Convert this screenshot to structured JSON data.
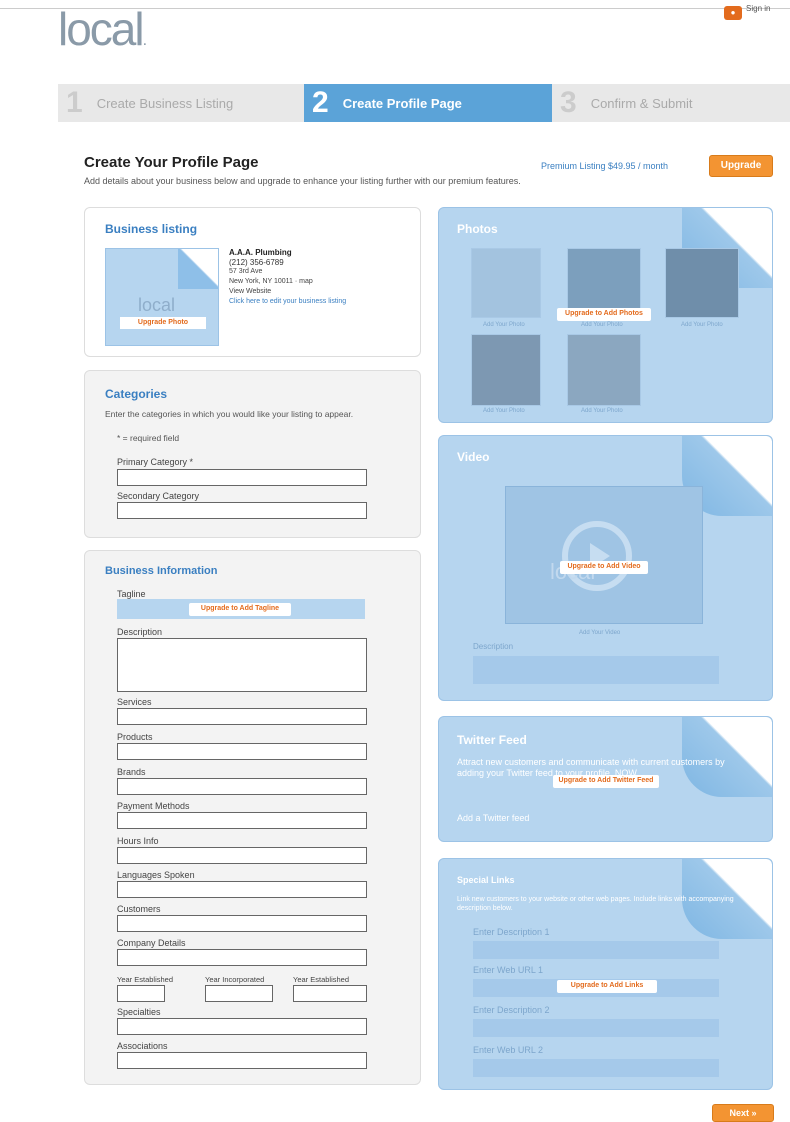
{
  "header": {
    "logo": "local",
    "logo_dot": ".",
    "signin": "Sign in"
  },
  "steps": [
    {
      "num": "1",
      "label": "Create Business Listing"
    },
    {
      "num": "2",
      "label": "Create Profile Page"
    },
    {
      "num": "3",
      "label": "Confirm & Submit"
    }
  ],
  "page": {
    "title": "Create Your Profile Page",
    "subtitle": "Add details about your business below and upgrade to enhance your listing further with our premium features.",
    "premium_text": "Premium Listing $49.95 / month",
    "upgrade_label": "Upgrade"
  },
  "business_listing": {
    "title": "Business listing",
    "name": "A.A.A. Plumbing",
    "phone": "(212) 356-6789",
    "address1": "57 3rd Ave",
    "address2": "New York, NY 10011 · map",
    "website": "View Website",
    "edit_link": "Click here to edit your business listing",
    "logo_text": "local",
    "upgrade_photo": "Upgrade Photo"
  },
  "categories": {
    "title": "Categories",
    "intro": "Enter the categories in which you would like your listing to appear.",
    "required_note": "* = required field",
    "primary_label": "Primary Category *",
    "secondary_label": "Secondary Category"
  },
  "business_info": {
    "title": "Business Information",
    "tagline_label": "Tagline",
    "tagline_btn": "Upgrade to Add Tagline",
    "description_label": "Description",
    "fields": [
      "Services",
      "Products",
      "Brands",
      "Payment Methods",
      "Hours Info",
      "Languages Spoken",
      "Customers",
      "Company Details"
    ],
    "triple": [
      "Year Established",
      "Year Incorporated",
      "Year Established"
    ],
    "specialties_label": "Specialties",
    "associations_label": "Associations"
  },
  "photos": {
    "title": "Photos",
    "upgrade_btn": "Upgrade to Add Photos",
    "captions": [
      "Add Your Photo",
      "Add Your Photo",
      "Add Your Photo",
      "Add Your Photo",
      "Add Your Photo"
    ]
  },
  "video": {
    "title": "Video",
    "upgrade_btn": "Upgrade to Add Video",
    "caption": "Add Your Video",
    "description_label": "Description",
    "logo_text": "local"
  },
  "twitter": {
    "title": "Twitter Feed",
    "text": "Attract new customers and communicate with current customers by adding your Twitter feed to your profile. NOW.",
    "link": "Add a Twitter feed",
    "upgrade_btn": "Upgrade to Add Twitter Feed"
  },
  "special_links": {
    "title": "Special Links",
    "intro": "Link new customers to your website or other web pages. Include links with accompanying description below.",
    "desc1": "Enter Description 1",
    "url1": "Enter Web URL 1",
    "desc2": "Enter Description 2",
    "url2": "Enter Web URL 2",
    "upgrade_btn": "Upgrade to Add Links"
  },
  "next_label": "Next »",
  "colors": {
    "accent": "#5ba3d8",
    "orange": "#f39432",
    "link": "#3a7fc1"
  }
}
